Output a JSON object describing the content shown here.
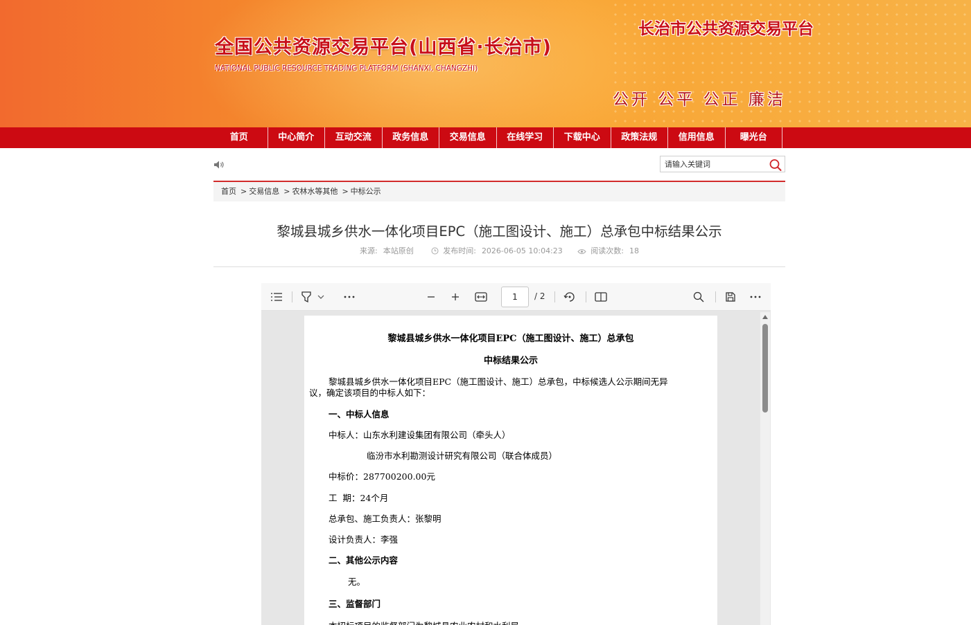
{
  "banner": {
    "title": "全国公共资源交易平台(山西省·长治市)",
    "subtitle": "NATIONAL PUBLIC RESOURCE TRADING PLATFORM (SHANXI, CHANGZHI)",
    "right_title": "长治市公共资源交易平台",
    "slogan": "公开 公平 公正 廉洁"
  },
  "nav": {
    "items": [
      "首页",
      "中心简介",
      "互动交流",
      "政务信息",
      "交易信息",
      "在线学习",
      "下载中心",
      "政策法规",
      "信用信息",
      "曝光台"
    ]
  },
  "search": {
    "placeholder": "请输入关键词"
  },
  "breadcrumb": {
    "items": [
      "首页",
      "交易信息",
      "农林水等其他",
      "中标公示"
    ],
    "separator": ">"
  },
  "article": {
    "title": "黎城县城乡供水一体化项目EPC（施工图设计、施工）总承包中标结果公示",
    "source_label": "来源:",
    "source": "本站原创",
    "time_label": "发布时间:",
    "time": "2026-06-05 10:04:23",
    "views_label": "阅读次数:",
    "views": "18"
  },
  "pdf": {
    "page_current": "1",
    "page_total": "/ 2",
    "content": {
      "heading1": "黎城县城乡供水一体化项目EPC（施工图设计、施工）总承包",
      "heading2": "中标结果公示",
      "intro_line1": "黎城县城乡供水一体化项目EPC（施工图设计、施工）总承包，中标候选人公示期间无异",
      "intro_line2": "议，确定该项目的中标人如下：",
      "section1": "一、中标人信息",
      "winner_line1": "中标人：山东水利建设集团有限公司（牵头人）",
      "winner_line2": "临汾市水利勘测设计研究有限公司（联合体成员）",
      "price": "中标价：287700200.00元",
      "period": "工  期：24个月",
      "manager": "总承包、施工负责人：张黎明",
      "designer": "设计负责人：李强",
      "section2": "二、其他公示内容",
      "other": "无。",
      "section3": "三、监督部门",
      "supervision": "本招标项目的监督部门为黎城县农业农村和水利局"
    }
  },
  "colors": {
    "nav_red": "#cc0a12",
    "banner_orange": "#f5902c",
    "title_red": "#c8101a"
  },
  "icons": [
    "speaker-icon",
    "search-icon",
    "clock-icon",
    "eye-icon",
    "toc-icon",
    "highlighter-icon",
    "chevron-down-icon",
    "more-icon",
    "zoom-out-icon",
    "zoom-in-icon",
    "fit-width-icon",
    "rotate-icon",
    "two-page-icon",
    "search-icon",
    "save-icon",
    "more-icon"
  ]
}
